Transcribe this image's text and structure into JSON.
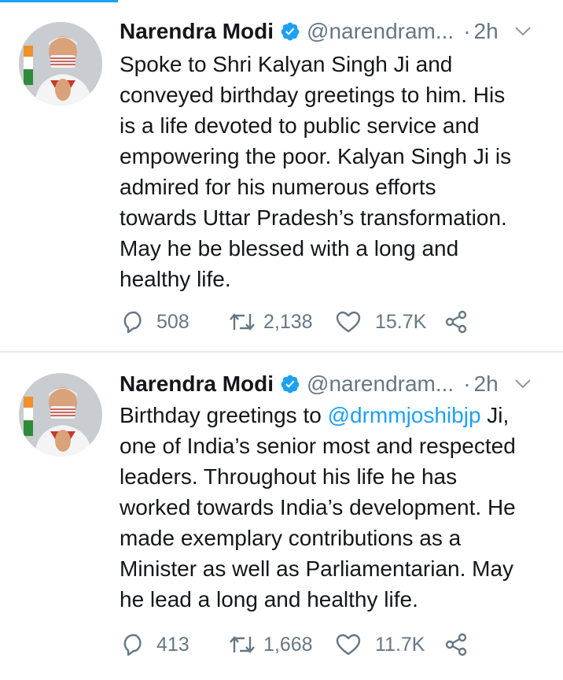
{
  "tweets": [
    {
      "author": "Narendra Modi",
      "handle": "@narendram...",
      "separator": "·",
      "time": "2h",
      "lines": [
        "Spoke to Shri Kalyan Singh Ji and",
        "conveyed birthday greetings to him. His",
        "is a life devoted to public service and",
        "empowering the poor. Kalyan Singh Ji is",
        "admired for his numerous efforts",
        "towards Uttar Pradesh’s transformation.",
        "May he be blessed with a long and",
        "healthy life."
      ],
      "replies": "508",
      "retweets": "2,138",
      "likes": "15.7K"
    },
    {
      "author": "Narendra Modi",
      "handle": "@narendram...",
      "separator": "·",
      "time": "2h",
      "line1_prefix": "Birthday greetings to ",
      "line1_mention": "@drmmjoshibjp",
      "line1_suffix": " Ji,",
      "lines": [
        "one of India’s senior most and respected",
        "leaders. Throughout his life he has",
        "worked towards India’s development. He",
        "made exemplary contributions as a",
        "Minister as well as Parliamentarian. May",
        "he lead a long and healthy life."
      ],
      "replies": "413",
      "retweets": "1,668",
      "likes": "11.7K"
    }
  ],
  "colors": {
    "accent": "#1da1f2",
    "secondary_text": "#657786",
    "primary_text": "#14171a",
    "divider": "#e6ecf0"
  },
  "icons": [
    "verified-badge-icon",
    "chevron-down-icon",
    "reply-icon",
    "retweet-icon",
    "like-icon",
    "share-icon"
  ]
}
